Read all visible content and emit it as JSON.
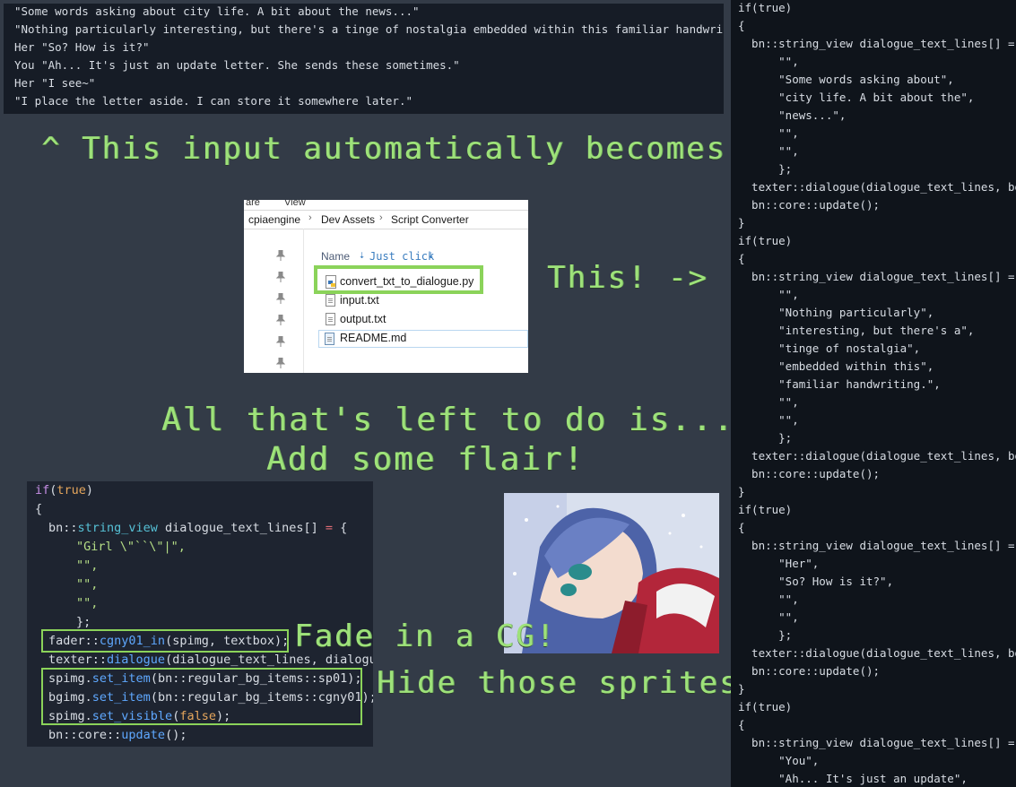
{
  "input_text": {
    "lines": [
      "\"Some words asking about city life. A bit about the news...\"",
      "\"Nothing particularly interesting, but there's a tinge of nostalgia embedded within this familiar handwriting.\"",
      "Her \"So? How is it?\"",
      "You \"Ah... It's just an update letter. She sends these sometimes.\"",
      "Her \"I see~\"",
      "\"I place the letter aside. I can store it somewhere later.\""
    ]
  },
  "captions": {
    "becomes": "^ This input automatically becomes...",
    "this_arrow": "This! ->",
    "all_thats_left": "All that's left to do is...",
    "add_flair": "Add some flair!",
    "fade_cg": "Fade in a CG!",
    "hide_sprites": "Hide those sprites!"
  },
  "explorer": {
    "menu": [
      "are",
      "View"
    ],
    "breadcrumb": [
      "cpiaengine",
      "Dev Assets",
      "Script Converter"
    ],
    "column_name": "Name",
    "annotation": "Just click",
    "files": [
      "convert_txt_to_dialogue.py",
      "input.txt",
      "output.txt",
      "README.md"
    ]
  },
  "code": {
    "if_kw": "if",
    "true_kw": "true",
    "open_brace": "{",
    "close_brace": "}",
    "ns_bn": "bn::",
    "type_sv": "string_view",
    "array_decl": " dialogue_text_lines[] ",
    "eq": "=",
    "open_arr": " {",
    "girl_str": "\"Girl \\\"``\\\"|\",",
    "empty_str": "\"\",",
    "close_arr": "};",
    "fader_ns": "fader::",
    "fader_fn": "cgny01_in",
    "fader_args": "(spimg, textbox);",
    "texter_ns": "texter::",
    "texter_fn": "dialogue",
    "texter_args": "(dialogue_text_lines, dialogue_",
    "spimg_1": "spimg.",
    "set_item": "set_item",
    "spimg_1_args": "(bn::regular_bg_items::sp01);",
    "bgimg": "bgimg.",
    "bgimg_args": "(bn::regular_bg_items::cgny01);",
    "spimg_2": "spimg.",
    "set_visible": "set_visible",
    "false_kw": "false",
    "spimg_2_end": ");",
    "core_ns": "bn::core::",
    "update_fn": "update",
    "update_end": "();"
  },
  "right_code": {
    "lines": [
      "if(true)",
      "{",
      "  bn::string_view dialogue_text_lines[] = {",
      "      \"\",",
      "      \"Some words asking about\",",
      "      \"city life. A bit about the\",",
      "      \"news...\",",
      "      \"\",",
      "      \"\",",
      "      };",
      "  texter::dialogue(dialogue_text_lines, bgpos",
      "  bn::core::update();",
      "}",
      "if(true)",
      "{",
      "  bn::string_view dialogue_text_lines[] = {",
      "      \"\",",
      "      \"Nothing particularly\",",
      "      \"interesting, but there's a\",",
      "      \"tinge of nostalgia\",",
      "      \"embedded within this\",",
      "      \"familiar handwriting.\",",
      "      \"\",",
      "      \"\",",
      "      };",
      "  texter::dialogue(dialogue_text_lines, bgpos",
      "  bn::core::update();",
      "}",
      "if(true)",
      "{",
      "  bn::string_view dialogue_text_lines[] = {",
      "      \"Her\",",
      "      \"So? How is it?\",",
      "      \"\",",
      "      \"\",",
      "      };",
      "  texter::dialogue(dialogue_text_lines, bgpos",
      "  bn::core::update();",
      "}",
      "if(true)",
      "{",
      "  bn::string_view dialogue_text_lines[] = {",
      "      \"You\",",
      "      \"Ah... It's just an update\","
    ]
  },
  "colors": {
    "background": "#333b47",
    "caption_green": "#9ee27a",
    "highlight_green": "#8bd35a",
    "code_bg": "#1e2430",
    "right_panel_bg": "#0f141b"
  }
}
